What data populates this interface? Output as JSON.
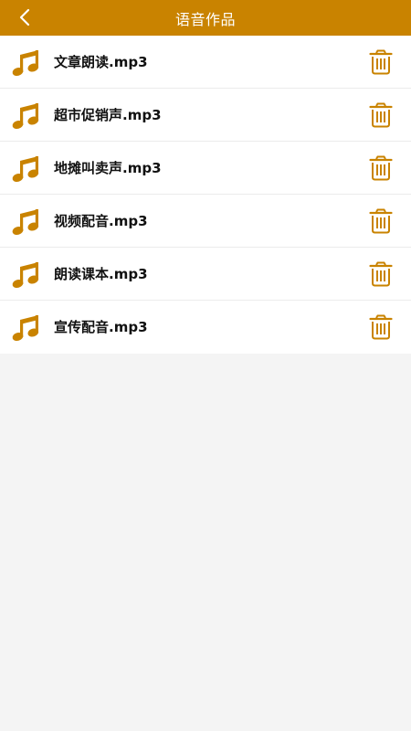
{
  "header": {
    "title": "语音作品",
    "back_icon": "chevron-left-icon"
  },
  "colors": {
    "accent": "#c98300",
    "icon": "#c98300",
    "list_bg": "#ffffff",
    "page_bg": "#f4f4f4",
    "text": "#111111"
  },
  "files": [
    {
      "name": "文章朗读.mp3",
      "icon": "music-note-icon",
      "action_icon": "trash-icon"
    },
    {
      "name": "超市促销声.mp3",
      "icon": "music-note-icon",
      "action_icon": "trash-icon"
    },
    {
      "name": "地摊叫卖声.mp3",
      "icon": "music-note-icon",
      "action_icon": "trash-icon"
    },
    {
      "name": "视频配音.mp3",
      "icon": "music-note-icon",
      "action_icon": "trash-icon"
    },
    {
      "name": "朗读课本.mp3",
      "icon": "music-note-icon",
      "action_icon": "trash-icon"
    },
    {
      "name": "宣传配音.mp3",
      "icon": "music-note-icon",
      "action_icon": "trash-icon"
    }
  ]
}
